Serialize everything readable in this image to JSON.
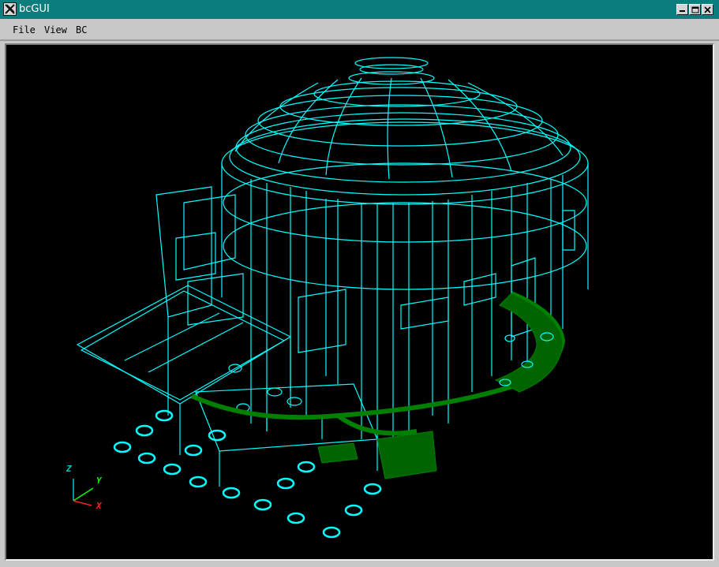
{
  "window": {
    "title": "bcGUI",
    "icon": "x-icon",
    "controls": [
      "minimize-icon",
      "maximize-icon",
      "close-icon"
    ]
  },
  "menu": {
    "items": [
      {
        "label": "File"
      },
      {
        "label": "View"
      },
      {
        "label": "BC"
      }
    ]
  },
  "viewport": {
    "background": "#000000",
    "wireframe_color": "#00ffff",
    "floor_color": "#008000",
    "axes": {
      "z": {
        "label": "Z",
        "color": "#00c8c8"
      },
      "y": {
        "label": "Y",
        "color": "#00ff00"
      },
      "x": {
        "label": "X",
        "color": "#ff2020"
      }
    }
  },
  "colors": {
    "titlebar": "#0c7d7d",
    "window_bg": "#c8c8c8"
  }
}
